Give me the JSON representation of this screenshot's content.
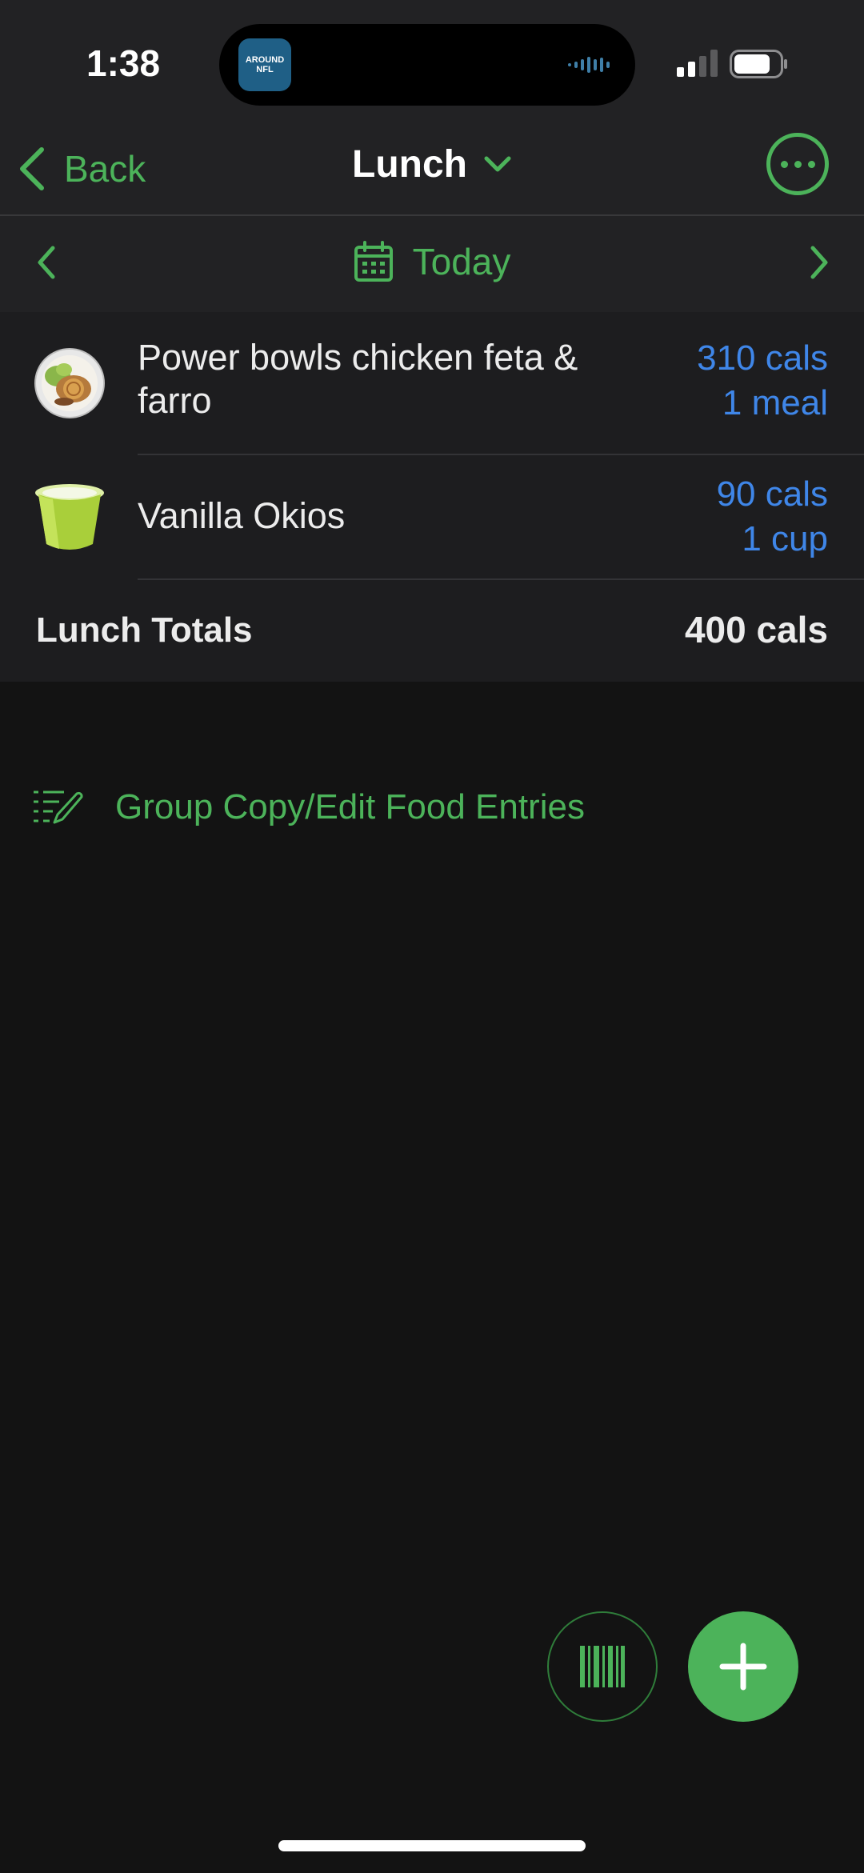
{
  "status_bar": {
    "time": "1:38",
    "live_activity_app": "AROUND\nNFL"
  },
  "nav": {
    "back_label": "Back",
    "title": "Lunch"
  },
  "date_bar": {
    "label": "Today"
  },
  "food_entries": [
    {
      "name": "Power bowls chicken feta & farro",
      "calories": "310 cals",
      "serving": "1 meal",
      "icon": "salad-bowl-icon"
    },
    {
      "name": "Vanilla Okios",
      "calories": "90 cals",
      "serving": "1 cup",
      "icon": "yogurt-cup-icon"
    }
  ],
  "totals": {
    "label": "Lunch Totals",
    "value": "400 cals"
  },
  "actions": {
    "group_copy_label": "Group Copy/Edit Food Entries"
  },
  "colors": {
    "accent_green": "#4cb35a",
    "calorie_blue": "#3f86e8",
    "background": "#131313",
    "panel": "#1d1d1f"
  }
}
